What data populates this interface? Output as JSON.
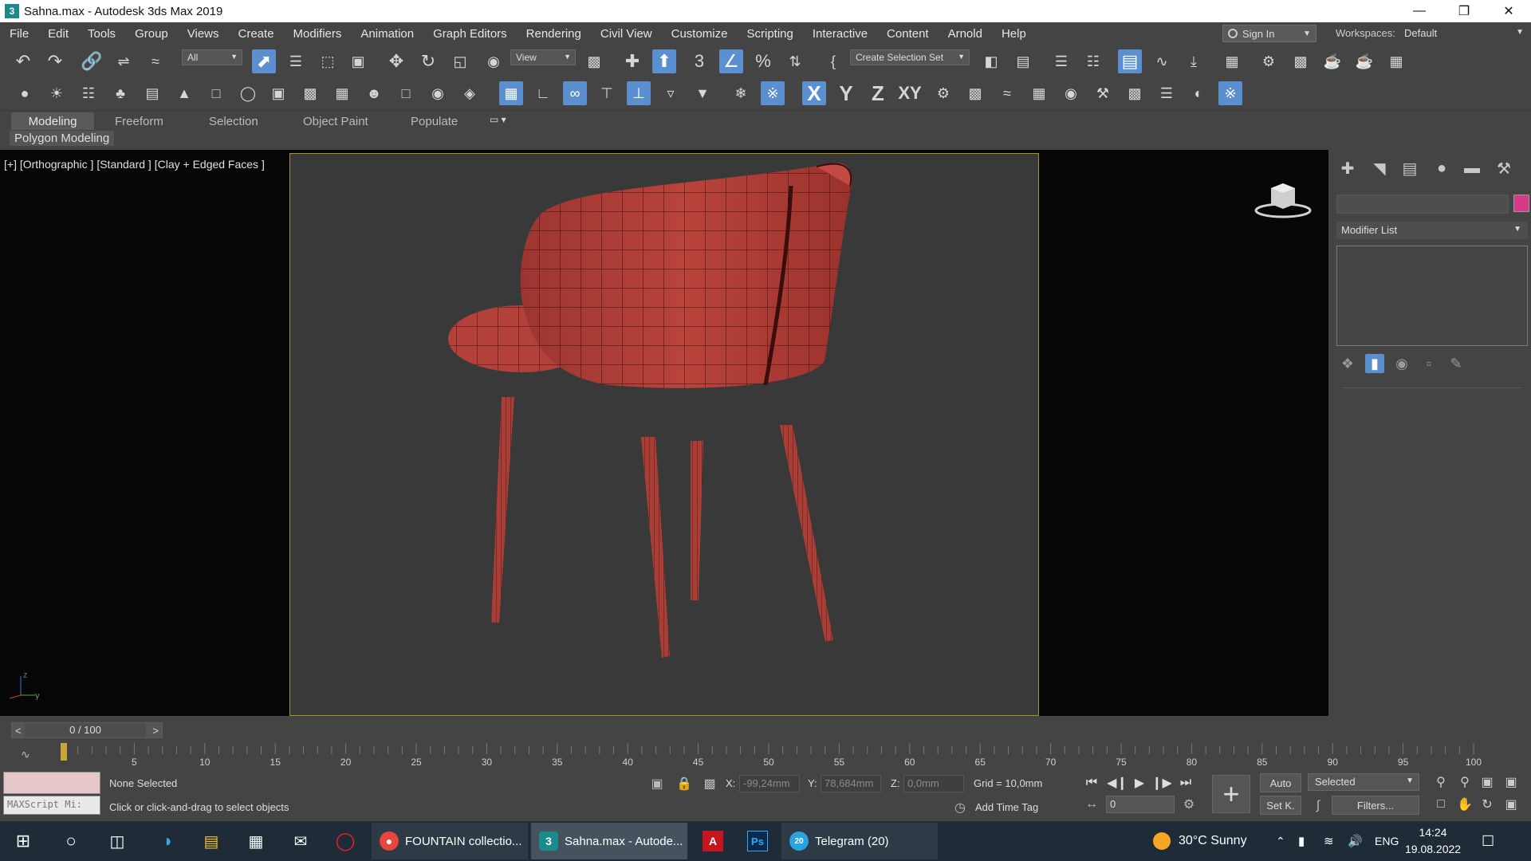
{
  "window": {
    "title": "Sahna.max - Autodesk 3ds Max 2019",
    "app_icon": "3",
    "controls": [
      "minimize-icon",
      "restore-icon",
      "close-icon"
    ]
  },
  "menu": {
    "items": [
      "File",
      "Edit",
      "Tools",
      "Group",
      "Views",
      "Create",
      "Modifiers",
      "Animation",
      "Graph Editors",
      "Rendering",
      "Civil View",
      "Customize",
      "Scripting",
      "Interactive",
      "Content",
      "Arnold",
      "Help"
    ],
    "sign_in": "Sign In",
    "workspaces_label": "Workspaces:",
    "workspace_value": "Default"
  },
  "toolbar": {
    "selection_filter": "All",
    "ref_coord": "View",
    "named_selection": "Create Selection Set"
  },
  "axis_buttons": {
    "x": "X",
    "y": "Y",
    "z": "Z",
    "xy": "XY"
  },
  "ribbon": {
    "tabs": [
      "Modeling",
      "Freeform",
      "Selection",
      "Object Paint",
      "Populate"
    ],
    "active_tab": "Modeling",
    "sub_label": "Polygon Modeling"
  },
  "viewport": {
    "label": "[+] [Orthographic ] [Standard ] [Clay + Edged Faces ]",
    "object_color": "#b3413a",
    "wire_color": "#3a0e0c",
    "axis": {
      "z": "z",
      "y": "y"
    }
  },
  "command_panel": {
    "tabs": [
      "create-icon",
      "modify-icon",
      "hierarchy-icon",
      "motion-icon",
      "display-icon",
      "utilities-icon"
    ],
    "object_name": "",
    "object_color": "#d63a89",
    "modifier_list": "Modifier List"
  },
  "timeline": {
    "frame_display": "0 / 100",
    "prev": "<",
    "next": ">",
    "ticks": [
      "5",
      "10",
      "15",
      "20",
      "25",
      "30",
      "35",
      "40",
      "45",
      "50",
      "55",
      "60",
      "65",
      "70",
      "75",
      "80",
      "85",
      "90",
      "95",
      "100"
    ],
    "current_frame": 0
  },
  "status": {
    "selection": "None Selected",
    "prompt": "Click or click-and-drag to select objects",
    "maxscript": "MAXScript Mi:",
    "x_label": "X:",
    "x_value": "-99,24mm",
    "y_label": "Y:",
    "y_value": "78,684mm",
    "z_label": "Z:",
    "z_value": "0,0mm",
    "grid": "Grid = 10,0mm",
    "add_time_tag": "Add Time Tag",
    "frame_value": "0",
    "auto": "Auto",
    "set_key": "Set K.",
    "selected_dd": "Selected",
    "filters": "Filters..."
  },
  "taskbar": {
    "apps": [
      {
        "label": "FOUNTAIN collectio...",
        "icon": "chrome-icon"
      },
      {
        "label": "Sahna.max - Autode...",
        "icon": "3dsmax-icon"
      },
      {
        "label": "Telegram (20)",
        "icon": "telegram-icon"
      }
    ],
    "icon_letters": {
      "acrobat": "A",
      "photoshop": "Ps",
      "max": "3",
      "telegram_badge": "20"
    },
    "weather": "30°C  Sunny",
    "lang": "ENG",
    "time": "14:24",
    "date": "19.08.2022"
  }
}
